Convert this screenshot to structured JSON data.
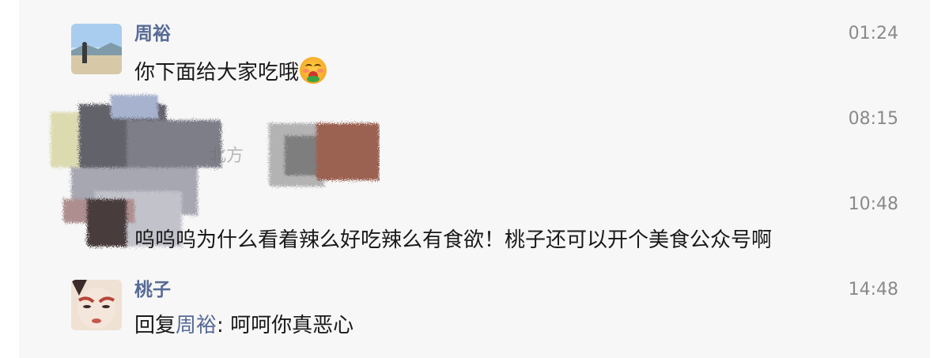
{
  "comments": [
    {
      "author": "周裕",
      "time": "01:24",
      "text": "你下面给大家吃哦",
      "emoji": "drooling-face-emoji"
    },
    {
      "author": "",
      "time": "08:15",
      "partial_text": "北方"
    },
    {
      "author": "",
      "time": "10:48",
      "text": "呜呜呜为什么看着辣么好吃辣么有食欲！桃子还可以开个美食公众号啊"
    },
    {
      "author": "桃子",
      "time": "14:48",
      "reply_prefix": "回复",
      "reply_to": "周裕",
      "reply_sep": ": ",
      "text": "呵呵你真恶心"
    }
  ],
  "colors": {
    "name": "#576b95",
    "text": "#191919",
    "time": "#8a8a8a",
    "background": "#f7f7f7"
  }
}
